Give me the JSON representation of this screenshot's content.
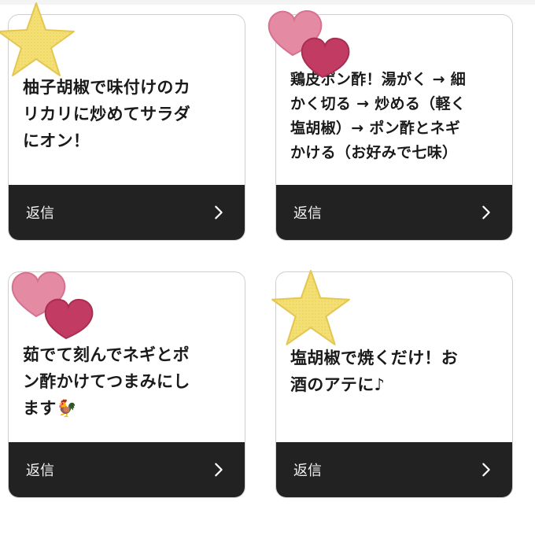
{
  "cards": [
    {
      "text": "柚子胡椒で味付けのカ\nリカリに炒めてサラダ\nにオン！",
      "sticker": "star",
      "reply_label": "返信"
    },
    {
      "text": "鶏皮ポン酢！湯がく → 細\nかく切る → 炒める（軽く\n塩胡椒）→ ポン酢とネギ\nかける（お好みで七味）",
      "sticker": "hearts",
      "reply_label": "返信"
    },
    {
      "text": "茹でて刻んでネギとポ\nン酢かけてつまみにし\nます🐓",
      "sticker": "hearts",
      "reply_label": "返信"
    },
    {
      "text": "塩胡椒で焼くだけ！お\n酒のアテに♪",
      "sticker": "star",
      "reply_label": "返信"
    }
  ],
  "colors": {
    "reply_bar": "#222222",
    "star_yellow": "#f1dc6a",
    "heart_pink": "#e07c98",
    "heart_dark": "#c23b63"
  },
  "icons": [
    "star-sticker-icon",
    "hearts-sticker-icon",
    "chevron-right-icon"
  ]
}
